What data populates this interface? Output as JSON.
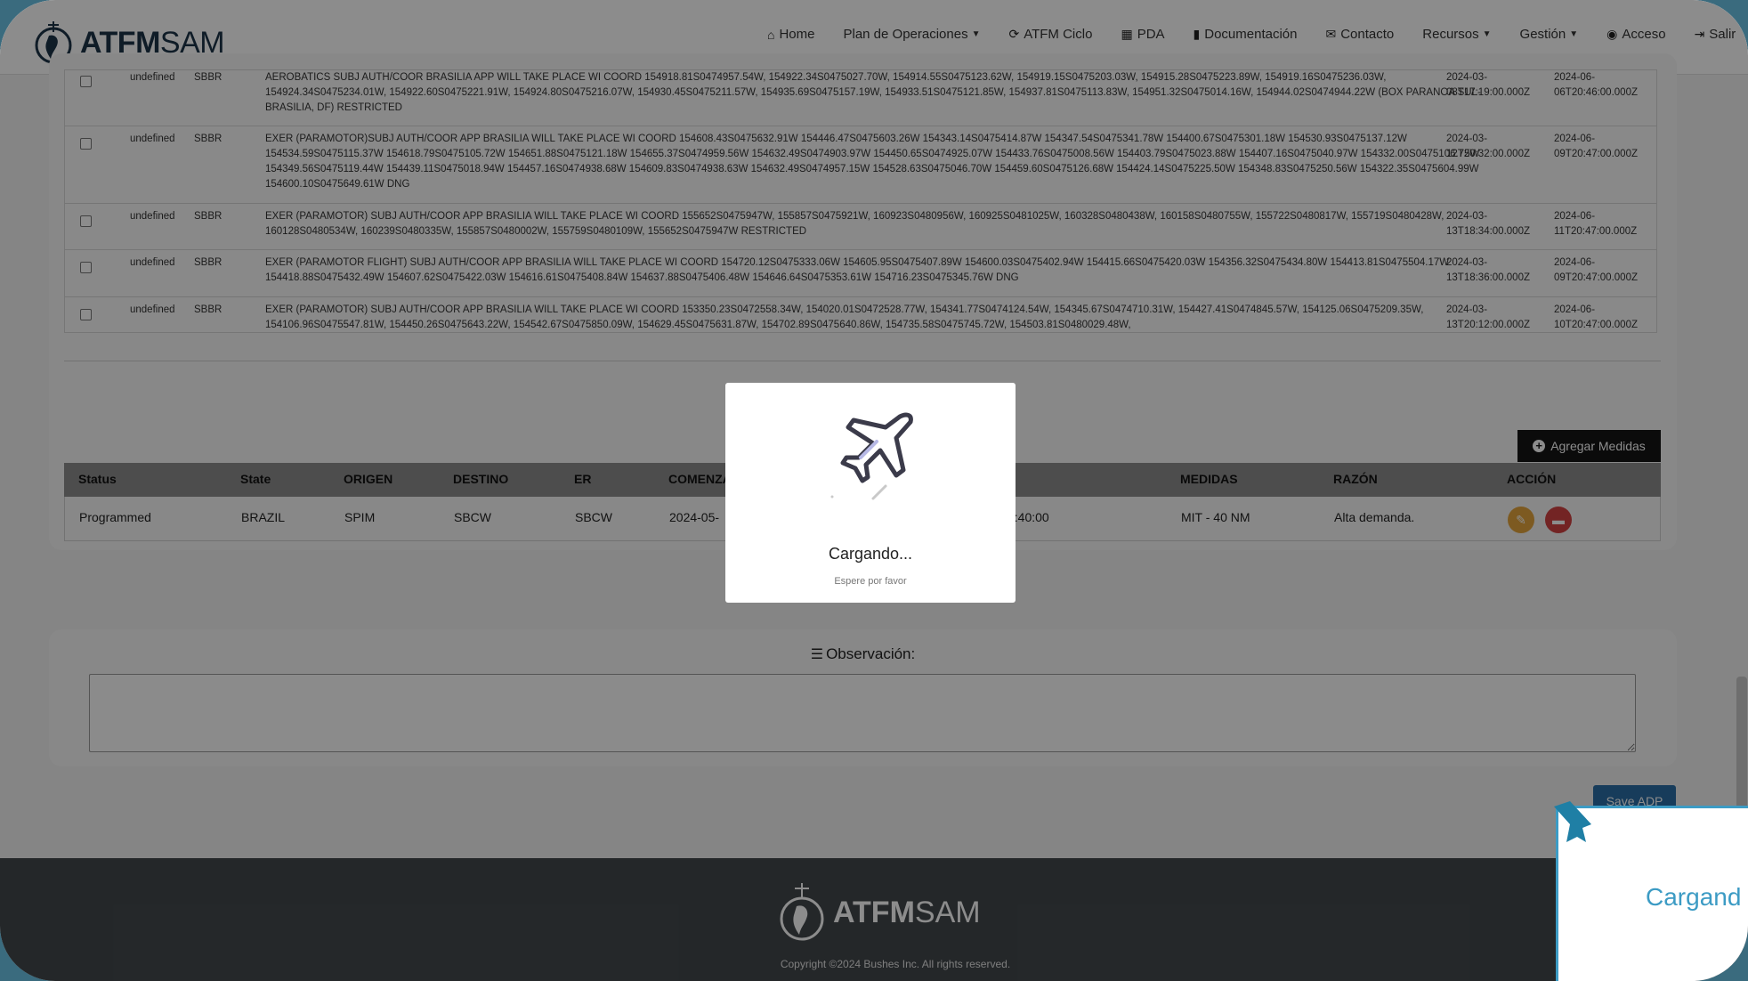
{
  "brand": {
    "name_bold": "ATFM",
    "name_light": "SAM"
  },
  "nav": [
    {
      "label": "Home",
      "icon": "home-icon",
      "glyph": "⌂",
      "dropdown": false
    },
    {
      "label": "Plan de Operaciones",
      "icon": "",
      "glyph": "",
      "dropdown": true
    },
    {
      "label": "ATFM Ciclo",
      "icon": "refresh-icon",
      "glyph": "⟳",
      "dropdown": false
    },
    {
      "label": "PDA",
      "icon": "table-icon",
      "glyph": "▦",
      "dropdown": false
    },
    {
      "label": "Documentación",
      "icon": "book-icon",
      "glyph": "▮",
      "dropdown": false
    },
    {
      "label": "Contacto",
      "icon": "envelope-icon",
      "glyph": "✉",
      "dropdown": false
    },
    {
      "label": "Recursos",
      "icon": "",
      "glyph": "",
      "dropdown": true
    },
    {
      "label": "Gestión",
      "icon": "",
      "glyph": "",
      "dropdown": true
    },
    {
      "label": "Acceso",
      "icon": "user-icon",
      "glyph": "👤",
      "dropdown": false
    },
    {
      "label": "Salir",
      "icon": "sign-out-icon",
      "glyph": "⇥",
      "dropdown": false
    }
  ],
  "notams": [
    {
      "col1": "undefined",
      "col2": "SBBR",
      "text": "AEROBATICS SUBJ AUTH/COOR BRASILIA APP WILL TAKE PLACE WI COORD 154918.81S0474957.54W, 154922.34S0475027.70W, 154914.55S0475123.62W, 154919.15S0475203.03W, 154915.28S0475223.89W, 154919.16S0475236.03W, 154924.34S0475234.01W, 154922.60S0475221.91W, 154924.80S0475216.07W, 154930.45S0475211.57W, 154935.69S0475157.19W, 154933.51S0475121.85W, 154937.81S0475113.83W, 154951.32S0475014.16W, 154944.02S0474944.22W (BOX PARANOA SUL-BRASILIA, DF) RESTRICTED",
      "start": "2024-03-08T17:19:00.000Z",
      "end": "2024-06-06T20:46:00.000Z"
    },
    {
      "col1": "undefined",
      "col2": "SBBR",
      "text": "EXER (PARAMOTOR)SUBJ AUTH/COOR APP BRASILIA WILL TAKE PLACE WI COORD 154608.43S0475632.91W 154446.47S0475603.26W 154343.14S0475414.87W 154347.54S0475341.78W 154400.67S0475301.18W 154530.93S0475137.12W 154534.59S0475115.37W 154618.79S0475105.72W 154651.88S0475121.18W 154655.37S0474959.56W 154632.49S0474903.97W 154450.65S0474925.07W 154433.76S0475008.56W 154403.79S0475023.88W 154407.16S0475040.97W 154332.00S0475106.75W 154349.56S0475119.44W 154439.11S0475018.94W 154457.16S0474938.68W 154609.83S0474938.63W 154632.49S0474957.15W 154528.63S0475046.70W 154459.60S0475126.68W 154424.14S0475225.50W 154348.83S0475250.56W 154322.35S0475604.99W 154600.10S0475649.61W DNG",
      "start": "2024-03-12T20:32:00.000Z",
      "end": "2024-06-09T20:47:00.000Z"
    },
    {
      "col1": "undefined",
      "col2": "SBBR",
      "text": "EXER (PARAMOTOR) SUBJ AUTH/COOR APP BRASILIA WILL TAKE PLACE WI COORD 155652S0475947W, 155857S0475921W, 160923S0480956W, 160925S0481025W, 160328S0480438W, 160158S0480755W, 155722S0480817W, 155719S0480428W, 160128S0480534W, 160239S0480335W, 155857S0480002W, 155759S0480109W, 155652S0475947W RESTRICTED",
      "start": "2024-03-13T18:34:00.000Z",
      "end": "2024-06-11T20:47:00.000Z"
    },
    {
      "col1": "undefined",
      "col2": "SBBR",
      "text": "EXER (PARAMOTOR FLIGHT) SUBJ AUTH/COOR APP BRASILIA WILL TAKE PLACE WI COORD 154720.12S0475333.06W 154605.95S0475407.89W 154600.03S0475402.94W 154415.66S0475420.03W 154356.32S0475434.80W 154413.81S0475504.17W 154418.88S0475432.49W 154607.62S0475422.03W 154616.61S0475408.84W 154637.88S0475406.48W 154646.64S0475353.61W 154716.23S0475345.76W DNG",
      "start": "2024-03-13T18:36:00.000Z",
      "end": "2024-06-09T20:47:00.000Z"
    },
    {
      "col1": "undefined",
      "col2": "SBBR",
      "text": "EXER (PARAMOTOR) SUBJ AUTH/COOR APP BRASILIA WILL TAKE PLACE WI COORD 153350.23S0472558.34W, 154020.01S0472528.77W, 154341.77S0474124.54W, 154345.67S0474710.31W, 154427.41S0474845.57W, 154125.06S0475209.35W, 154106.96S0475547.81W, 154450.26S0475643.22W, 154542.67S0475850.09W, 154629.45S0475631.87W, 154702.89S0475640.86W, 154735.58S0475745.72W, 154503.81S0480029.48W,",
      "start": "2024-03-13T20:12:00.000Z",
      "end": "2024-06-10T20:47:00.000Z"
    }
  ],
  "measures": {
    "add_label": "Agregar Medidas",
    "headers": [
      "Status",
      "State",
      "ORIGEN",
      "DESTINO",
      "ER",
      "COMENZA",
      "MEDIDAS",
      "RAZÓN",
      "ACCIÓN"
    ],
    "rows": [
      {
        "status": "Programmed",
        "state": "BRAZIL",
        "origen": "SPIM",
        "destino": "SBCW",
        "er": "SBCW",
        "comienza": "2024-05-",
        "hidden_tail": "0:40:00",
        "medidas": "MIT - 40 NM",
        "razon": "Alta demanda."
      }
    ]
  },
  "observation": {
    "title": "Observación:",
    "value": ""
  },
  "save_label": "Save ADP",
  "footer": {
    "copyright": "Copyright ©2024 Bushes Inc. All rights reserved."
  },
  "modal": {
    "title": "Cargando...",
    "subtitle": "Espere por favor"
  },
  "side_loader": {
    "text": "Cargand"
  },
  "colors": {
    "edit": "#e3a53c",
    "delete": "#d24343",
    "accent": "#3c9bc4",
    "dark_button": "#141414"
  }
}
